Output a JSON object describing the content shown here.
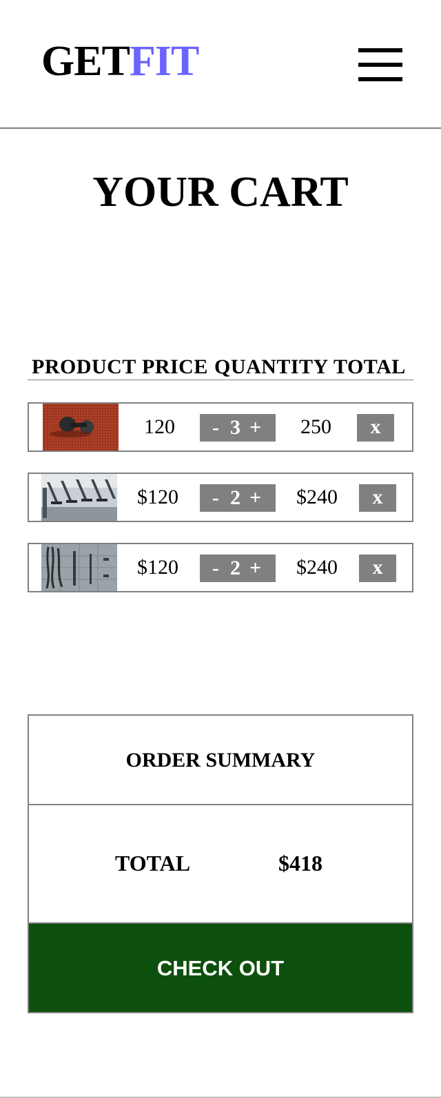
{
  "header": {
    "logo_primary": "GET",
    "logo_accent": "FIT",
    "accent_color": "#6c63ff",
    "menu_icon": "hamburger-menu-icon"
  },
  "page": {
    "title": "YOUR CART"
  },
  "table": {
    "columns": [
      "PRODUCT",
      "PRICE",
      "QUANTITY",
      "TOTAL"
    ]
  },
  "cart_items": [
    {
      "image": "dumbbells-on-red-track-photo",
      "price": "120",
      "quantity": "3",
      "total": "250",
      "remove_label": "x"
    },
    {
      "image": "gym-treadmills-photo",
      "price": "$120",
      "quantity": "2",
      "total": "$240",
      "remove_label": "x"
    },
    {
      "image": "battle-ropes-wall-photo",
      "price": "$120",
      "quantity": "2",
      "total": "$240",
      "remove_label": "x"
    }
  ],
  "controls": {
    "minus_label": "-",
    "plus_label": "+",
    "button_color": "#808080"
  },
  "summary": {
    "title": "ORDER SUMMARY",
    "total_label": "TOTAL",
    "total_value": "$418",
    "checkout_label": "CHECK OUT",
    "checkout_color": "#0d4f0d"
  }
}
